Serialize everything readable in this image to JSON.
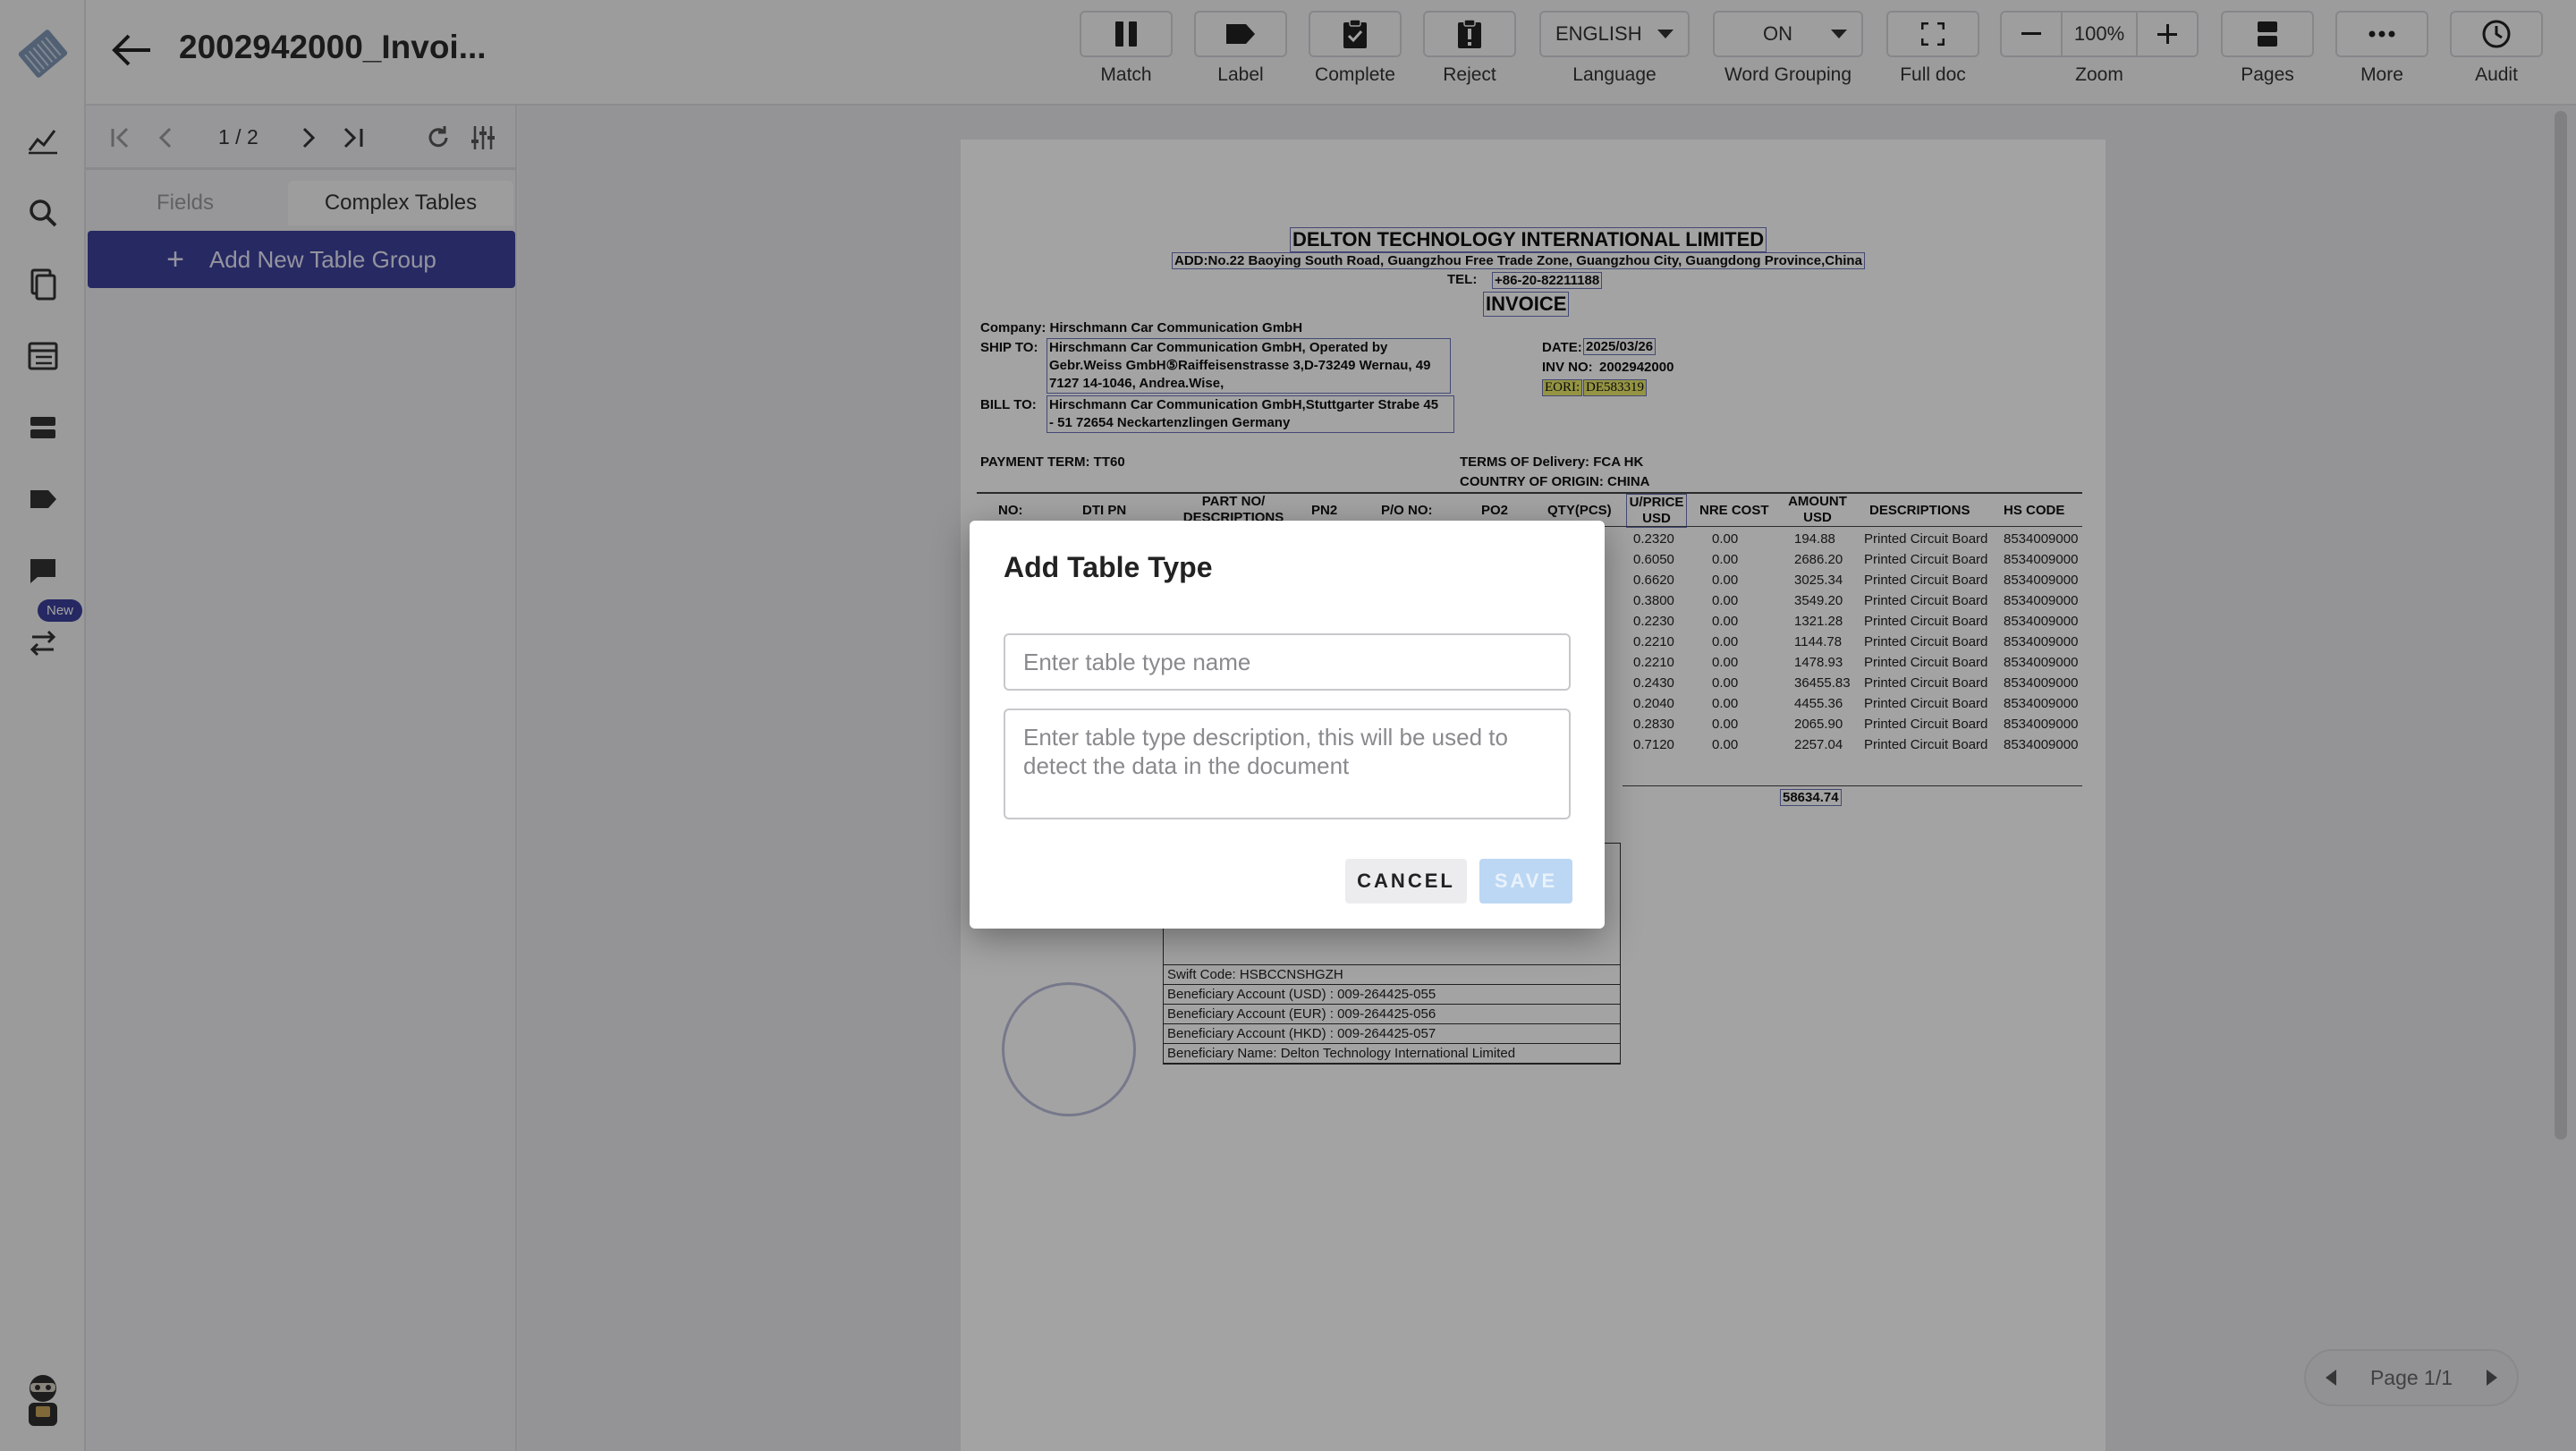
{
  "header": {
    "title": "2002942000_Invoi...",
    "tools": [
      {
        "label": "Match",
        "icon": "pause-icon"
      },
      {
        "label": "Label",
        "icon": "tag-icon"
      },
      {
        "label": "Complete",
        "icon": "clipboard-check-icon"
      },
      {
        "label": "Reject",
        "icon": "clipboard-alert-icon"
      },
      {
        "label": "Language",
        "value": "ENGLISH"
      },
      {
        "label": "Word Grouping",
        "value": "ON"
      },
      {
        "label": "Full doc",
        "icon": "fullscreen-icon"
      },
      {
        "label": "Zoom",
        "value": "100%"
      },
      {
        "label": "Pages",
        "icon": "pages-icon"
      },
      {
        "label": "More",
        "icon": "more-icon"
      },
      {
        "label": "Audit",
        "icon": "clock-icon"
      }
    ]
  },
  "rail": {
    "new_badge": "New"
  },
  "panel": {
    "page_count": "1 / 2",
    "tabs": [
      "Fields",
      "Complex Tables"
    ],
    "add_group_label": "Add New Table Group"
  },
  "document": {
    "company_name": "DELTON TECHNOLOGY INTERNATIONAL LIMITED",
    "address": "ADD:No.22 Baoying South Road, Guangzhou Free Trade Zone, Guangzhou City, Guangdong Province,China",
    "tel_label": "TEL:",
    "tel": "+86-20-82211188",
    "heading": "INVOICE",
    "company_line": "Company:  Hirschmann Car Communication GmbH",
    "ship_to_label": "SHIP TO:",
    "ship_to": [
      "Hirschmann Car Communication GmbH, Operated by",
      "Gebr.Weiss GmbH⑤Raiffeisenstrasse 3,D-73249 Wernau, 49",
      "7127 14-1046, Andrea.Wise,"
    ],
    "bill_to_label": "BILL TO:",
    "bill_to": [
      "Hirschmann Car Communication GmbH,Stuttgarter Strabe 45",
      "- 51 72654 Neckartenzlingen Germany"
    ],
    "date_label": "DATE:",
    "date": "2025/03/26",
    "inv_label": "INV NO:",
    "inv_no": "2002942000",
    "eori_label": "EORI:",
    "eori": "DE583319",
    "payment_term": "PAYMENT TERM: TT60",
    "terms_delivery": "TERMS OF Delivery: FCA HK",
    "origin": "COUNTRY OF ORIGIN: CHINA",
    "columns": [
      "NO:",
      "DTI PN",
      "PART NO/ DESCRIPTIONS",
      "PN2",
      "P/O NO:",
      "PO2",
      "QTY(PCS)",
      "U/PRICE USD",
      "NRE COST",
      "AMOUNT USD",
      "DESCRIPTIONS",
      "HS CODE"
    ],
    "rows": [
      {
        "price": "0.2320",
        "nre": "0.00",
        "amount": "194.88",
        "desc": "Printed Circuit Board",
        "hs": "8534009000"
      },
      {
        "price": "0.6050",
        "nre": "0.00",
        "amount": "2686.20",
        "desc": "Printed Circuit Board",
        "hs": "8534009000"
      },
      {
        "price": "0.6620",
        "nre": "0.00",
        "amount": "3025.34",
        "desc": "Printed Circuit Board",
        "hs": "8534009000"
      },
      {
        "price": "0.3800",
        "nre": "0.00",
        "amount": "3549.20",
        "desc": "Printed Circuit Board",
        "hs": "8534009000"
      },
      {
        "price": "0.2230",
        "nre": "0.00",
        "amount": "1321.28",
        "desc": "Printed Circuit Board",
        "hs": "8534009000"
      },
      {
        "price": "0.2210",
        "nre": "0.00",
        "amount": "1144.78",
        "desc": "Printed Circuit Board",
        "hs": "8534009000"
      },
      {
        "price": "0.2210",
        "nre": "0.00",
        "amount": "1478.93",
        "desc": "Printed Circuit Board",
        "hs": "8534009000"
      },
      {
        "price": "0.2430",
        "nre": "0.00",
        "amount": "36455.83",
        "desc": "Printed Circuit Board",
        "hs": "8534009000"
      },
      {
        "price": "0.2040",
        "nre": "0.00",
        "amount": "4455.36",
        "desc": "Printed Circuit Board",
        "hs": "8534009000"
      },
      {
        "price": "0.2830",
        "nre": "0.00",
        "amount": "2065.90",
        "desc": "Printed Circuit Board",
        "hs": "8534009000"
      },
      {
        "price": "0.7120",
        "nre": "0.00",
        "amount": "2257.04",
        "desc": "Printed Circuit Board",
        "hs": "8534009000"
      }
    ],
    "total": "58634.74",
    "bank_lines": [
      "Swift Code: HSBCCNSHGZH",
      "Beneficiary Account   (USD)  : 009-264425-055",
      "Beneficiary Account   (EUR)  : 009-264425-056",
      "Beneficiary Account   (HKD)  : 009-264425-057",
      "Beneficiary Name: Delton Technology International Limited"
    ]
  },
  "page_nav": {
    "label": "Page 1/1"
  },
  "modal": {
    "title": "Add Table Type",
    "name_placeholder": "Enter table type name",
    "desc_placeholder": "Enter table type description, this will be used to detect the data in the document",
    "cancel_label": "CANCEL",
    "save_label": "SAVE"
  },
  "colors": {
    "accent": "#3d419b",
    "save_disabled": "#bcd7f3"
  }
}
